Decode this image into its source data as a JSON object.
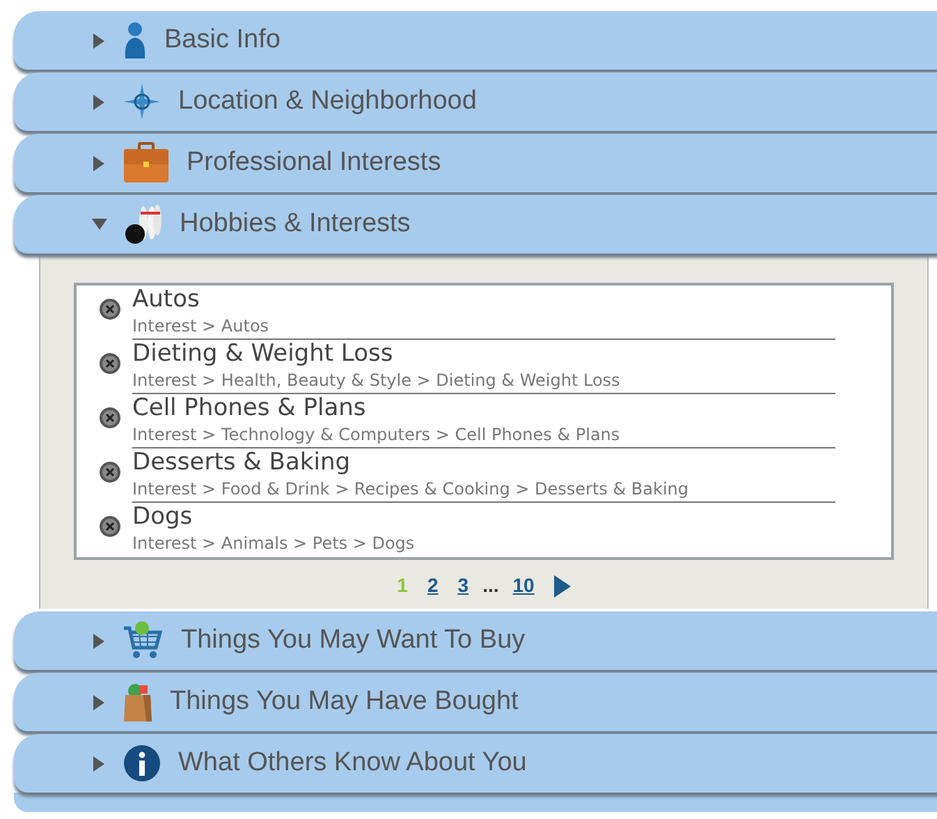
{
  "sections": [
    {
      "title": "Basic Info",
      "expanded": false
    },
    {
      "title": "Location & Neighborhood",
      "expanded": false
    },
    {
      "title": "Professional Interests",
      "expanded": false
    },
    {
      "title": "Hobbies & Interests",
      "expanded": true,
      "items": [
        {
          "title": "Autos",
          "path": "Interest > Autos"
        },
        {
          "title": "Dieting & Weight Loss",
          "path": "Interest > Health, Beauty & Style > Dieting & Weight Loss"
        },
        {
          "title": "Cell Phones & Plans",
          "path": "Interest > Technology & Computers > Cell Phones & Plans"
        },
        {
          "title": "Desserts & Baking",
          "path": "Interest > Food & Drink > Recipes & Cooking > Desserts & Baking"
        },
        {
          "title": "Dogs",
          "path": "Interest > Animals > Pets > Dogs"
        }
      ],
      "pagination": {
        "pages": [
          {
            "label": "1",
            "selected": true
          },
          {
            "label": "2",
            "selected": false
          },
          {
            "label": "3",
            "selected": false
          },
          {
            "label": "...",
            "kind": "ellipsis"
          },
          {
            "label": "10",
            "selected": false
          }
        ]
      }
    },
    {
      "title": "Things You May Want To Buy",
      "expanded": false
    },
    {
      "title": "Things You May Have Bought",
      "expanded": false
    },
    {
      "title": "What Others Know About You",
      "expanded": false
    }
  ]
}
